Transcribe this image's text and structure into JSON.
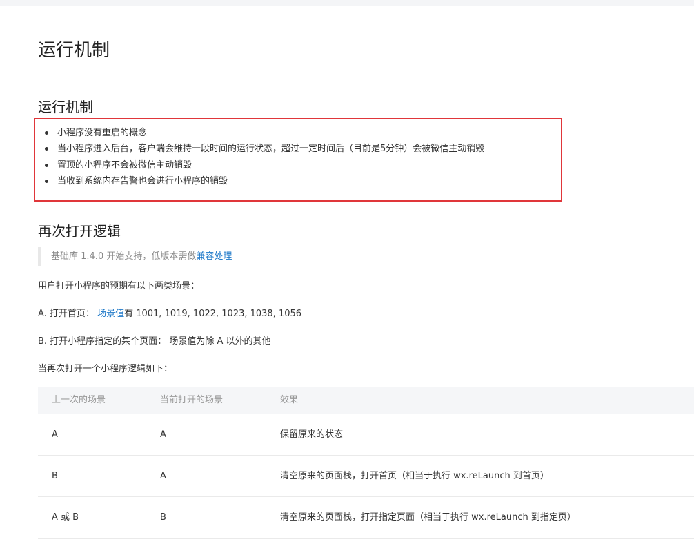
{
  "page": {
    "title": "运行机制"
  },
  "mechanism": {
    "heading": "运行机制",
    "items": [
      "小程序没有重启的概念",
      "当小程序进入后台，客户端会维持一段时间的运行状态，超过一定时间后（目前是5分钟）会被微信主动销毁",
      "置顶的小程序不会被微信主动销毁",
      "当收到系统内存告警也会进行小程序的销毁"
    ]
  },
  "reopen": {
    "heading": "再次打开逻辑",
    "notice_text": "基础库 1.4.0 开始支持，低版本需做",
    "notice_link": "兼容处理",
    "intro": "用户打开小程序的预期有以下两类场景：",
    "scene_a_prefix": "A. 打开首页：",
    "scene_a_link": "场景值",
    "scene_a_suffix": "有 1001, 1019, 1022, 1023, 1038, 1056",
    "scene_b": "B. 打开小程序指定的某个页面： 场景值为除 A 以外的其他",
    "logic_intro": "当再次打开一个小程序逻辑如下："
  },
  "table": {
    "headers": [
      "上一次的场景",
      "当前打开的场景",
      "效果"
    ],
    "rows": [
      [
        "A",
        "A",
        "保留原来的状态"
      ],
      [
        "B",
        "A",
        "清空原来的页面栈，打开首页（相当于执行 wx.reLaunch 到首页）"
      ],
      [
        "A 或 B",
        "B",
        "清空原来的页面栈，打开指定页面（相当于执行 wx.reLaunch 到指定页）"
      ]
    ]
  },
  "colors": {
    "highlight_border": "#e0363a",
    "link": "#1e78c8",
    "table_header_bg": "#f5f6f8"
  }
}
